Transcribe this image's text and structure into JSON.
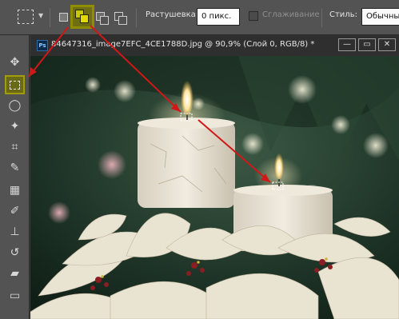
{
  "options_bar": {
    "feather_label": "Растушевка:",
    "feather_value": "0 пикс.",
    "antialias_label": "Сглаживание",
    "style_label": "Стиль:",
    "style_value": "Обычный"
  },
  "document": {
    "tab_title": "84647316_image7EFC_4CE1788D.jpg @ 90,9% (Слой 0, RGB/8) *",
    "app_icon_text": "Ps"
  },
  "toolbar": {
    "tools": [
      "move-tool-icon",
      "rect-marquee-icon",
      "lasso-icon",
      "magic-wand-icon",
      "crop-icon",
      "eyedropper-icon",
      "healing-icon",
      "brush-icon",
      "stamp-icon",
      "history-brush-icon",
      "eraser-icon",
      "gradient-icon"
    ]
  },
  "colors": {
    "highlight": "#8f8d00",
    "arrow": "#d01818",
    "panel": "#535353"
  }
}
